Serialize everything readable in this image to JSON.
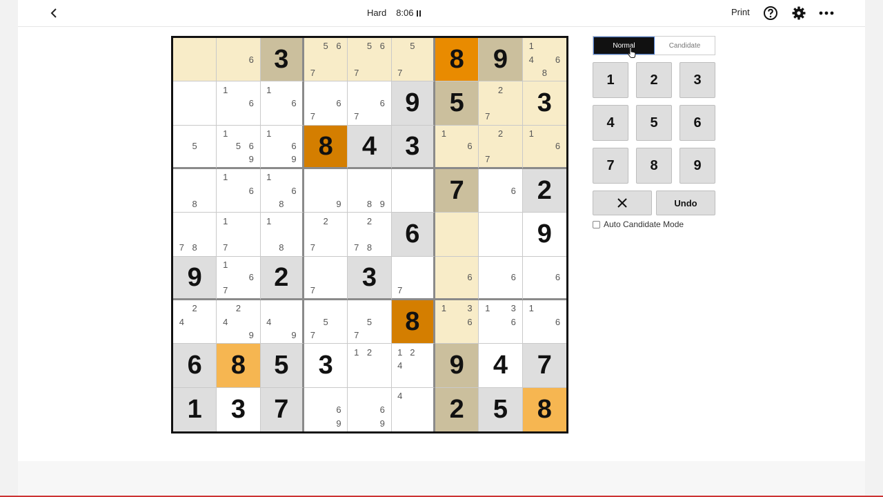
{
  "header": {
    "difficulty": "Hard",
    "timer": "8:06",
    "print_label": "Print",
    "icons": [
      "back-arrow-icon",
      "pause-icon",
      "help-icon",
      "gear-icon",
      "more-icon"
    ]
  },
  "controls": {
    "modes": [
      {
        "label": "Normal",
        "active": true
      },
      {
        "label": "Candidate",
        "active": false
      }
    ],
    "numbers": [
      "1",
      "2",
      "3",
      "4",
      "5",
      "6",
      "7",
      "8",
      "9"
    ],
    "undo_label": "Undo",
    "auto_candidate_label": "Auto Candidate Mode",
    "auto_candidate_checked": false
  },
  "colors": {
    "highlight_light": "#f8ecc8",
    "given_tan": "#cbbf9d",
    "gray_given": "#dedede",
    "orange_selected": "#e98b00",
    "orange_dark": "#d47e00",
    "orange_light": "#f6b651"
  },
  "board": [
    [
      {
        "c": [
          "",
          "",
          "",
          "",
          "",
          "",
          "",
          "",
          ""
        ],
        "bg": "L"
      },
      {
        "c": [
          "",
          "",
          "",
          "",
          "",
          "6",
          "",
          "",
          ""
        ],
        "bg": "L"
      },
      {
        "v": "3",
        "bg": "T"
      },
      {
        "c": [
          "",
          "5",
          "6",
          "",
          "",
          "",
          "7",
          "",
          ""
        ],
        "bg": "L"
      },
      {
        "c": [
          "",
          "5",
          "6",
          "",
          "",
          "",
          "7",
          "",
          ""
        ],
        "bg": "L"
      },
      {
        "c": [
          "",
          "5",
          "",
          "",
          "",
          "",
          "7",
          "",
          ""
        ],
        "bg": "L"
      },
      {
        "v": "8",
        "bg": "O"
      },
      {
        "v": "9",
        "bg": "T"
      },
      {
        "c": [
          "1",
          "",
          "",
          "4",
          "",
          "6",
          "",
          "8",
          ""
        ],
        "bg": "L"
      }
    ],
    [
      {
        "c": [
          "",
          "",
          "",
          "",
          "",
          "",
          "",
          "",
          ""
        ],
        "bg": "W"
      },
      {
        "c": [
          "1",
          "",
          "",
          "",
          "",
          "6",
          "",
          "",
          ""
        ],
        "bg": "W"
      },
      {
        "c": [
          "1",
          "",
          "",
          "",
          "",
          "6",
          "",
          "",
          ""
        ],
        "bg": "W"
      },
      {
        "c": [
          "",
          "",
          "",
          "",
          "",
          "6",
          "7",
          "",
          ""
        ],
        "bg": "W"
      },
      {
        "c": [
          "",
          "",
          "",
          "",
          "",
          "6",
          "7",
          "",
          ""
        ],
        "bg": "W"
      },
      {
        "v": "9",
        "bg": "G"
      },
      {
        "v": "5",
        "bg": "T"
      },
      {
        "c": [
          "",
          "2",
          "",
          "",
          "",
          "",
          "7",
          "",
          ""
        ],
        "bg": "L"
      },
      {
        "v": "3",
        "bg": "L"
      }
    ],
    [
      {
        "c": [
          "",
          "",
          "",
          "",
          "5",
          "",
          "",
          "",
          ""
        ],
        "bg": "W"
      },
      {
        "c": [
          "1",
          "",
          "",
          "",
          "5",
          "6",
          "",
          "",
          "9"
        ],
        "bg": "W"
      },
      {
        "c": [
          "1",
          "",
          "",
          "",
          "",
          "6",
          "",
          "",
          "9"
        ],
        "bg": "W"
      },
      {
        "v": "8",
        "bg": "D"
      },
      {
        "v": "4",
        "bg": "G"
      },
      {
        "v": "3",
        "bg": "G"
      },
      {
        "c": [
          "1",
          "",
          "",
          "",
          "",
          "6",
          "",
          "",
          ""
        ],
        "bg": "L"
      },
      {
        "c": [
          "",
          "2",
          "",
          "",
          "",
          "",
          "7",
          "",
          ""
        ],
        "bg": "L"
      },
      {
        "c": [
          "1",
          "",
          "",
          "",
          "",
          "6",
          "",
          "",
          ""
        ],
        "bg": "L"
      }
    ],
    [
      {
        "c": [
          "",
          "",
          "",
          "",
          "",
          "",
          "",
          "8",
          ""
        ],
        "bg": "W"
      },
      {
        "c": [
          "1",
          "",
          "",
          "",
          "",
          "6",
          "",
          "",
          ""
        ],
        "bg": "W"
      },
      {
        "c": [
          "1",
          "",
          "",
          "",
          "",
          "6",
          "",
          "8",
          ""
        ],
        "bg": "W"
      },
      {
        "c": [
          "",
          "",
          "",
          "",
          "",
          "",
          "",
          "",
          "9"
        ],
        "bg": "W"
      },
      {
        "c": [
          "",
          "",
          "",
          "",
          "",
          "",
          "",
          "8",
          "9"
        ],
        "bg": "W"
      },
      {
        "c": [
          "",
          "",
          "",
          "",
          "",
          "",
          "",
          "",
          ""
        ],
        "bg": "W"
      },
      {
        "v": "7",
        "bg": "T"
      },
      {
        "c": [
          "",
          "",
          "",
          "",
          "",
          "6",
          "",
          "",
          ""
        ],
        "bg": "W"
      },
      {
        "v": "2",
        "bg": "G"
      }
    ],
    [
      {
        "c": [
          "",
          "",
          "",
          "",
          "",
          "",
          "7",
          "8",
          ""
        ],
        "bg": "W"
      },
      {
        "c": [
          "1",
          "",
          "",
          "",
          "",
          "",
          "7",
          "",
          ""
        ],
        "bg": "W"
      },
      {
        "c": [
          "1",
          "",
          "",
          "",
          "",
          "",
          "",
          "8",
          ""
        ],
        "bg": "W"
      },
      {
        "c": [
          "",
          "2",
          "",
          "",
          "",
          "",
          "7",
          "",
          ""
        ],
        "bg": "W"
      },
      {
        "c": [
          "",
          "2",
          "",
          "",
          "",
          "",
          "7",
          "8",
          ""
        ],
        "bg": "W"
      },
      {
        "v": "6",
        "bg": "G"
      },
      {
        "c": [
          "",
          "",
          "",
          "",
          "",
          "",
          "",
          "",
          ""
        ],
        "bg": "L"
      },
      {
        "c": [
          "",
          "",
          "",
          "",
          "",
          "",
          "",
          "",
          ""
        ],
        "bg": "W"
      },
      {
        "v": "9",
        "bg": "W"
      }
    ],
    [
      {
        "v": "9",
        "bg": "G"
      },
      {
        "c": [
          "1",
          "",
          "",
          "",
          "",
          "6",
          "7",
          "",
          ""
        ],
        "bg": "W"
      },
      {
        "v": "2",
        "bg": "G"
      },
      {
        "c": [
          "",
          "",
          "",
          "",
          "",
          "",
          "7",
          "",
          ""
        ],
        "bg": "W"
      },
      {
        "v": "3",
        "bg": "G"
      },
      {
        "c": [
          "",
          "",
          "",
          "",
          "",
          "",
          "7",
          "",
          ""
        ],
        "bg": "W"
      },
      {
        "c": [
          "",
          "",
          "",
          "",
          "",
          "6",
          "",
          "",
          ""
        ],
        "bg": "L"
      },
      {
        "c": [
          "",
          "",
          "",
          "",
          "",
          "6",
          "",
          "",
          ""
        ],
        "bg": "W"
      },
      {
        "c": [
          "",
          "",
          "",
          "",
          "",
          "6",
          "",
          "",
          ""
        ],
        "bg": "W"
      }
    ],
    [
      {
        "c": [
          "",
          "2",
          "",
          "4",
          "",
          "",
          "",
          "",
          ""
        ],
        "bg": "W"
      },
      {
        "c": [
          "",
          "2",
          "",
          "4",
          "",
          "",
          "",
          "",
          "9"
        ],
        "bg": "W"
      },
      {
        "c": [
          "",
          "",
          "",
          "4",
          "",
          "",
          "",
          "",
          "9"
        ],
        "bg": "W"
      },
      {
        "c": [
          "",
          "",
          "",
          "",
          "5",
          "",
          "7",
          "",
          ""
        ],
        "bg": "W"
      },
      {
        "c": [
          "",
          "",
          "",
          "",
          "5",
          "",
          "7",
          "",
          ""
        ],
        "bg": "W"
      },
      {
        "v": "8",
        "bg": "D"
      },
      {
        "c": [
          "1",
          "",
          "3",
          "",
          "",
          "6",
          "",
          "",
          ""
        ],
        "bg": "L"
      },
      {
        "c": [
          "1",
          "",
          "3",
          "",
          "",
          "6",
          "",
          "",
          ""
        ],
        "bg": "W"
      },
      {
        "c": [
          "1",
          "",
          "",
          "",
          "",
          "6",
          "",
          "",
          ""
        ],
        "bg": "W"
      }
    ],
    [
      {
        "v": "6",
        "bg": "G"
      },
      {
        "v": "8",
        "bg": "P"
      },
      {
        "v": "5",
        "bg": "G"
      },
      {
        "v": "3",
        "bg": "W"
      },
      {
        "c": [
          "1",
          "2",
          "",
          "",
          "",
          "",
          "",
          "",
          ""
        ],
        "bg": "W"
      },
      {
        "c": [
          "1",
          "2",
          "",
          "4",
          "",
          "",
          "",
          "",
          ""
        ],
        "bg": "W"
      },
      {
        "v": "9",
        "bg": "T"
      },
      {
        "v": "4",
        "bg": "W"
      },
      {
        "v": "7",
        "bg": "G"
      }
    ],
    [
      {
        "v": "1",
        "bg": "G"
      },
      {
        "v": "3",
        "bg": "W"
      },
      {
        "v": "7",
        "bg": "G"
      },
      {
        "c": [
          "",
          "",
          "",
          "",
          "",
          "6",
          "",
          "",
          "9"
        ],
        "bg": "W"
      },
      {
        "c": [
          "",
          "",
          "",
          "",
          "",
          "6",
          "",
          "",
          "9"
        ],
        "bg": "W"
      },
      {
        "c": [
          "4",
          "",
          "",
          "",
          "",
          "",
          "",
          "",
          ""
        ],
        "bg": "W"
      },
      {
        "v": "2",
        "bg": "T"
      },
      {
        "v": "5",
        "bg": "G"
      },
      {
        "v": "8",
        "bg": "P"
      }
    ]
  ]
}
